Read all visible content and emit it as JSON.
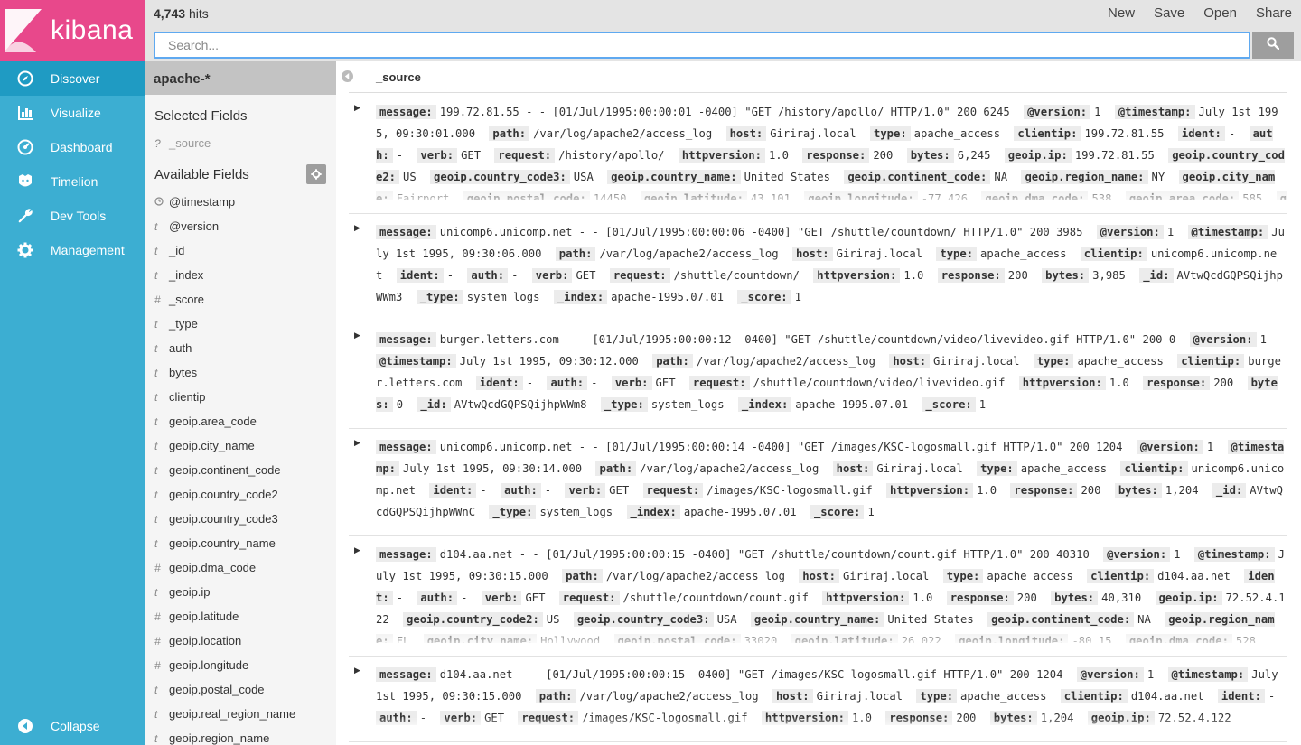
{
  "app": {
    "logo_text": "kibana"
  },
  "nav": {
    "items": [
      {
        "label": "Discover",
        "icon": "compass-icon"
      },
      {
        "label": "Visualize",
        "icon": "bar-chart-icon"
      },
      {
        "label": "Dashboard",
        "icon": "dashboard-icon"
      },
      {
        "label": "Timelion",
        "icon": "timelion-icon"
      },
      {
        "label": "Dev Tools",
        "icon": "wrench-icon"
      },
      {
        "label": "Management",
        "icon": "gear-icon"
      }
    ],
    "collapse_label": "Collapse",
    "active_color": "#1f9bc3",
    "brand_color": "#e8488b"
  },
  "topbar": {
    "hits_count": "4,743",
    "hits_label": "hits",
    "actions": [
      "New",
      "Save",
      "Open",
      "Share"
    ],
    "search_placeholder": "Search..."
  },
  "sidebar": {
    "index_pattern": "apache-*",
    "selected_title": "Selected Fields",
    "selected_fields": [
      {
        "type": "?",
        "name": "_source"
      }
    ],
    "available_title": "Available Fields",
    "available_fields": [
      {
        "type": "clock",
        "name": "@timestamp"
      },
      {
        "type": "t",
        "name": "@version"
      },
      {
        "type": "t",
        "name": "_id"
      },
      {
        "type": "t",
        "name": "_index"
      },
      {
        "type": "#",
        "name": "_score"
      },
      {
        "type": "t",
        "name": "_type"
      },
      {
        "type": "t",
        "name": "auth"
      },
      {
        "type": "t",
        "name": "bytes"
      },
      {
        "type": "t",
        "name": "clientip"
      },
      {
        "type": "t",
        "name": "geoip.area_code"
      },
      {
        "type": "t",
        "name": "geoip.city_name"
      },
      {
        "type": "t",
        "name": "geoip.continent_code"
      },
      {
        "type": "t",
        "name": "geoip.country_code2"
      },
      {
        "type": "t",
        "name": "geoip.country_code3"
      },
      {
        "type": "t",
        "name": "geoip.country_name"
      },
      {
        "type": "#",
        "name": "geoip.dma_code"
      },
      {
        "type": "t",
        "name": "geoip.ip"
      },
      {
        "type": "#",
        "name": "geoip.latitude"
      },
      {
        "type": "#",
        "name": "geoip.location"
      },
      {
        "type": "#",
        "name": "geoip.longitude"
      },
      {
        "type": "t",
        "name": "geoip.postal_code"
      },
      {
        "type": "t",
        "name": "geoip.real_region_name"
      },
      {
        "type": "t",
        "name": "geoip.region_name"
      }
    ]
  },
  "content": {
    "column_header": "_source",
    "documents": [
      {
        "truncated": true,
        "fields": [
          [
            "message:",
            "199.72.81.55 - - [01/Jul/1995:00:00:01 -0400] \"GET /history/apollo/ HTTP/1.0\" 200 6245"
          ],
          [
            "@version:",
            "1"
          ],
          [
            "@timestamp:",
            "July 1st 1995, 09:30:01.000"
          ],
          [
            "path:",
            "/var/log/apache2/access_log"
          ],
          [
            "host:",
            "Giriraj.local"
          ],
          [
            "type:",
            "apache_access"
          ],
          [
            "clientip:",
            "199.72.81.55"
          ],
          [
            "ident:",
            "-"
          ],
          [
            "auth:",
            "-"
          ],
          [
            "verb:",
            "GET"
          ],
          [
            "request:",
            "/history/apollo/"
          ],
          [
            "httpversion:",
            "1.0"
          ],
          [
            "response:",
            "200"
          ],
          [
            "bytes:",
            "6,245"
          ],
          [
            "geoip.ip:",
            "199.72.81.55"
          ],
          [
            "geoip.country_code2:",
            "US"
          ],
          [
            "geoip.country_code3:",
            "USA"
          ],
          [
            "geoip.country_name:",
            "United States"
          ],
          [
            "geoip.continent_code:",
            "NA"
          ],
          [
            "geoip.region_name:",
            "NY"
          ],
          [
            "geoip.city_name:",
            "Fairport"
          ],
          [
            "geoip.postal_code:",
            "14450"
          ],
          [
            "geoip.latitude:",
            "43.101"
          ],
          [
            "geoip.longitude:",
            "-77.426"
          ],
          [
            "geoip.dma_code:",
            "538"
          ],
          [
            "geoip.area_code:",
            "585"
          ],
          [
            "geoip.timezone:",
            "Am"
          ]
        ]
      },
      {
        "truncated": false,
        "fields": [
          [
            "message:",
            "unicomp6.unicomp.net - - [01/Jul/1995:00:00:06 -0400] \"GET /shuttle/countdown/ HTTP/1.0\" 200 3985"
          ],
          [
            "@version:",
            "1"
          ],
          [
            "@timestamp:",
            "July 1st 1995, 09:30:06.000"
          ],
          [
            "path:",
            "/var/log/apache2/access_log"
          ],
          [
            "host:",
            "Giriraj.local"
          ],
          [
            "type:",
            "apache_access"
          ],
          [
            "clientip:",
            "unicomp6.unicomp.net"
          ],
          [
            "ident:",
            "-"
          ],
          [
            "auth:",
            "-"
          ],
          [
            "verb:",
            "GET"
          ],
          [
            "request:",
            "/shuttle/countdown/"
          ],
          [
            "httpversion:",
            "1.0"
          ],
          [
            "response:",
            "200"
          ],
          [
            "bytes:",
            "3,985"
          ],
          [
            "_id:",
            "AVtwQcdGQPSQijhpWWm3"
          ],
          [
            "_type:",
            "system_logs"
          ],
          [
            "_index:",
            "apache-1995.07.01"
          ],
          [
            "_score:",
            "1"
          ]
        ]
      },
      {
        "truncated": false,
        "fields": [
          [
            "message:",
            "burger.letters.com - - [01/Jul/1995:00:00:12 -0400] \"GET /shuttle/countdown/video/livevideo.gif HTTP/1.0\" 200 0"
          ],
          [
            "@version:",
            "1"
          ],
          [
            "@timestamp:",
            "July 1st 1995, 09:30:12.000"
          ],
          [
            "path:",
            "/var/log/apache2/access_log"
          ],
          [
            "host:",
            "Giriraj.local"
          ],
          [
            "type:",
            "apache_access"
          ],
          [
            "clientip:",
            "burger.letters.com"
          ],
          [
            "ident:",
            "-"
          ],
          [
            "auth:",
            "-"
          ],
          [
            "verb:",
            "GET"
          ],
          [
            "request:",
            "/shuttle/countdown/video/livevideo.gif"
          ],
          [
            "httpversion:",
            "1.0"
          ],
          [
            "response:",
            "200"
          ],
          [
            "bytes:",
            "0"
          ],
          [
            "_id:",
            "AVtwQcdGQPSQijhpWWm8"
          ],
          [
            "_type:",
            "system_logs"
          ],
          [
            "_index:",
            "apache-1995.07.01"
          ],
          [
            "_score:",
            "1"
          ]
        ]
      },
      {
        "truncated": false,
        "fields": [
          [
            "message:",
            "unicomp6.unicomp.net - - [01/Jul/1995:00:00:14 -0400] \"GET /images/KSC-logosmall.gif HTTP/1.0\" 200 1204"
          ],
          [
            "@version:",
            "1"
          ],
          [
            "@timestamp:",
            "July 1st 1995, 09:30:14.000"
          ],
          [
            "path:",
            "/var/log/apache2/access_log"
          ],
          [
            "host:",
            "Giriraj.local"
          ],
          [
            "type:",
            "apache_access"
          ],
          [
            "clientip:",
            "unicomp6.unicomp.net"
          ],
          [
            "ident:",
            "-"
          ],
          [
            "auth:",
            "-"
          ],
          [
            "verb:",
            "GET"
          ],
          [
            "request:",
            "/images/KSC-logosmall.gif"
          ],
          [
            "httpversion:",
            "1.0"
          ],
          [
            "response:",
            "200"
          ],
          [
            "bytes:",
            "1,204"
          ],
          [
            "_id:",
            "AVtwQcdGQPSQijhpWWnC"
          ],
          [
            "_type:",
            "system_logs"
          ],
          [
            "_index:",
            "apache-1995.07.01"
          ],
          [
            "_score:",
            "1"
          ]
        ]
      },
      {
        "truncated": true,
        "fields": [
          [
            "message:",
            "d104.aa.net - - [01/Jul/1995:00:00:15 -0400] \"GET /shuttle/countdown/count.gif HTTP/1.0\" 200 40310"
          ],
          [
            "@version:",
            "1"
          ],
          [
            "@timestamp:",
            "July 1st 1995, 09:30:15.000"
          ],
          [
            "path:",
            "/var/log/apache2/access_log"
          ],
          [
            "host:",
            "Giriraj.local"
          ],
          [
            "type:",
            "apache_access"
          ],
          [
            "clientip:",
            "d104.aa.net"
          ],
          [
            "ident:",
            "-"
          ],
          [
            "auth:",
            "-"
          ],
          [
            "verb:",
            "GET"
          ],
          [
            "request:",
            "/shuttle/countdown/count.gif"
          ],
          [
            "httpversion:",
            "1.0"
          ],
          [
            "response:",
            "200"
          ],
          [
            "bytes:",
            "40,310"
          ],
          [
            "geoip.ip:",
            "72.52.4.122"
          ],
          [
            "geoip.country_code2:",
            "US"
          ],
          [
            "geoip.country_code3:",
            "USA"
          ],
          [
            "geoip.country_name:",
            "United States"
          ],
          [
            "geoip.continent_code:",
            "NA"
          ],
          [
            "geoip.region_name:",
            "FL"
          ],
          [
            "geoip.city_name:",
            "Hollywood"
          ],
          [
            "geoip.postal_code:",
            "33020"
          ],
          [
            "geoip.latitude:",
            "26.022"
          ],
          [
            "geoip.longitude:",
            "-80.15"
          ],
          [
            "geoip.dma_code:",
            "528"
          ]
        ]
      },
      {
        "truncated": true,
        "fields": [
          [
            "message:",
            "d104.aa.net - - [01/Jul/1995:00:00:15 -0400] \"GET /images/KSC-logosmall.gif HTTP/1.0\" 200 1204"
          ],
          [
            "@version:",
            "1"
          ],
          [
            "@timestamp:",
            "July 1st 1995, 09:30:15.000"
          ],
          [
            "path:",
            "/var/log/apache2/access_log"
          ],
          [
            "host:",
            "Giriraj.local"
          ],
          [
            "type:",
            "apache_access"
          ],
          [
            "clientip:",
            "d104.aa.net"
          ],
          [
            "ident:",
            "-"
          ],
          [
            "auth:",
            "-"
          ],
          [
            "verb:",
            "GET"
          ],
          [
            "request:",
            "/images/KSC-logosmall.gif"
          ],
          [
            "httpversion:",
            "1.0"
          ],
          [
            "response:",
            "200"
          ],
          [
            "bytes:",
            "1,204"
          ],
          [
            "geoip.ip:",
            "72.52.4.122"
          ]
        ]
      }
    ]
  }
}
